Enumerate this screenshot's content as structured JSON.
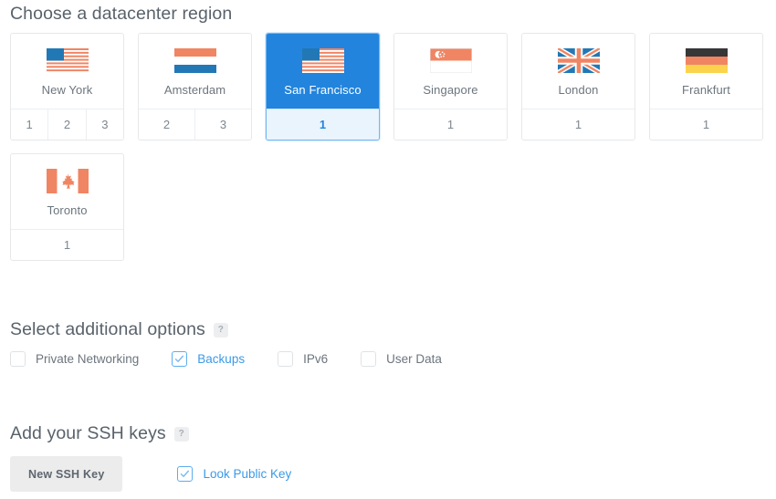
{
  "sections": {
    "region": {
      "title": "Choose a datacenter region"
    },
    "options": {
      "title": "Select additional options",
      "help": "?"
    },
    "ssh": {
      "title": "Add your SSH keys",
      "help": "?"
    }
  },
  "regions": [
    {
      "name": "New York",
      "flag": "us-flag-icon",
      "slots": [
        "1",
        "2",
        "3"
      ],
      "selected": false
    },
    {
      "name": "Amsterdam",
      "flag": "nl-flag-icon",
      "slots": [
        "2",
        "3"
      ],
      "selected": false
    },
    {
      "name": "San Francisco",
      "flag": "us-flag-icon",
      "slots": [
        "1"
      ],
      "selected": true
    },
    {
      "name": "Singapore",
      "flag": "sg-flag-icon",
      "slots": [
        "1"
      ],
      "selected": false
    },
    {
      "name": "London",
      "flag": "gb-flag-icon",
      "slots": [
        "1"
      ],
      "selected": false
    },
    {
      "name": "Frankfurt",
      "flag": "de-flag-icon",
      "slots": [
        "1"
      ],
      "selected": false
    },
    {
      "name": "Toronto",
      "flag": "ca-flag-icon",
      "slots": [
        "1"
      ],
      "selected": false
    }
  ],
  "options": [
    {
      "label": "Private Networking",
      "checked": false
    },
    {
      "label": "Backups",
      "checked": true
    },
    {
      "label": "IPv6",
      "checked": false
    },
    {
      "label": "User Data",
      "checked": false
    }
  ],
  "ssh": {
    "new_key_button": "New SSH Key",
    "public_key_option": {
      "label": "Look Public Key",
      "checked": true
    }
  },
  "colors": {
    "accent_blue": "#2284dd",
    "link_blue": "#3b9ae8",
    "selected_footer_bg": "#eaf4fd",
    "flag_salmon": "#f08563",
    "flag_blue": "#2278b5",
    "heading_grey": "#59626b",
    "card_border": "#e6e8ea",
    "button_grey": "#ececec"
  }
}
